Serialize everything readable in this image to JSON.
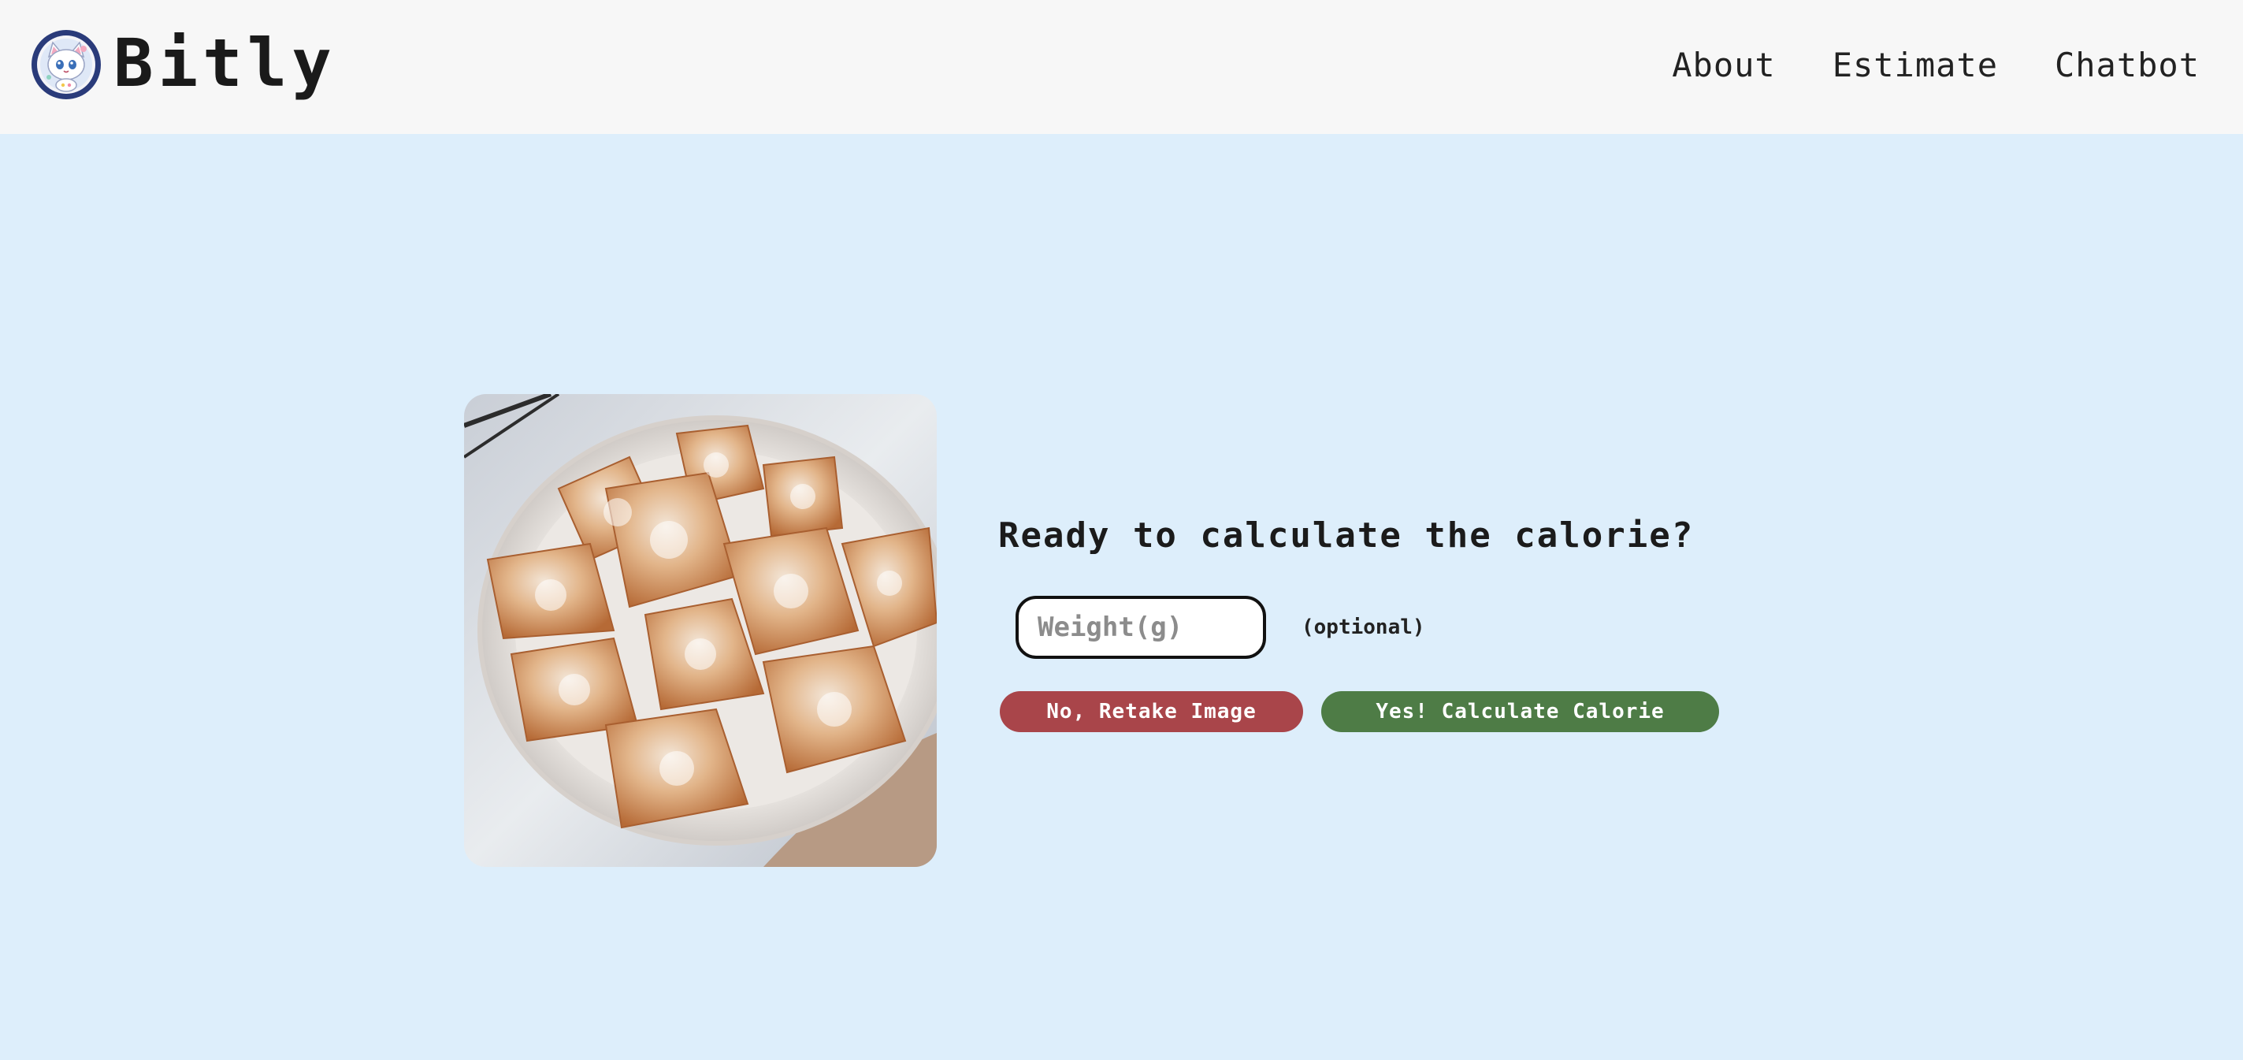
{
  "header": {
    "brand": "Bitly",
    "logo_icon": "cat-mascot-icon",
    "nav": [
      {
        "label": "About"
      },
      {
        "label": "Estimate"
      },
      {
        "label": "Chatbot"
      }
    ]
  },
  "main": {
    "photo_icon": "fried-pastries-photo",
    "prompt": "Ready to calculate the calorie?",
    "weight": {
      "placeholder": "Weight(g)",
      "value": "",
      "hint": "(optional)"
    },
    "buttons": {
      "retake_label": "No, Retake Image",
      "calculate_label": "Yes! Calculate Calorie"
    }
  },
  "colors": {
    "header_bg": "#f7f7f7",
    "page_bg": "#ddeefb",
    "retake": "#a9454a",
    "calculate": "#4e7c46"
  }
}
